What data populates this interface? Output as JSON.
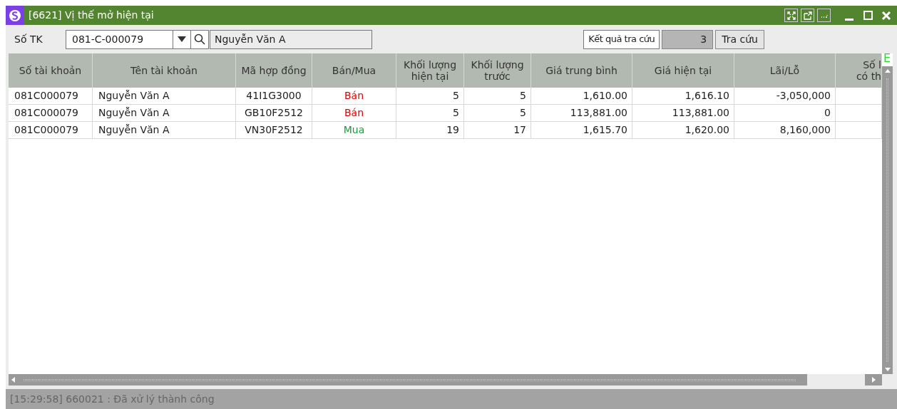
{
  "window": {
    "title": "[6621] Vị thế mở hiện tại"
  },
  "filter": {
    "label": "Số TK",
    "account": "081-C-000079",
    "name": "Nguyễn Văn A",
    "result_label": "Kết quả tra cứu",
    "result_count": "3",
    "search_button": "Tra cứu"
  },
  "table": {
    "columns": [
      {
        "lines": [
          "Số tài khoản"
        ]
      },
      {
        "lines": [
          "Tên tài khoản"
        ]
      },
      {
        "lines": [
          "Mã hợp đồng"
        ]
      },
      {
        "lines": [
          "Bán/Mua"
        ]
      },
      {
        "lines": [
          "Khối lượng",
          "hiện tại"
        ]
      },
      {
        "lines": [
          "Khối lượng",
          "trước"
        ]
      },
      {
        "lines": [
          "Giá trung bình"
        ]
      },
      {
        "lines": [
          "Giá hiện tại"
        ]
      },
      {
        "lines": [
          "Lãi/Lỗ"
        ]
      },
      {
        "lines": [
          "Số l",
          "có th"
        ]
      }
    ],
    "corner_mark": "E",
    "rows": [
      {
        "cells": [
          "081C000079",
          "Nguyễn Văn A",
          "41I1G3000",
          "Bán",
          "5",
          "5",
          "1,610.00",
          "1,616.10",
          "-3,050,000",
          ""
        ],
        "color": "#e00000"
      },
      {
        "cells": [
          "081C000079",
          "Nguyễn Văn A",
          "GB10F2512",
          "Bán",
          "5",
          "5",
          "113,881.00",
          "113,881.00",
          "0",
          ""
        ],
        "color": "#e00000"
      },
      {
        "cells": [
          "081C000079",
          "Nguyễn Văn A",
          "VN30F2512",
          "Mua",
          "19",
          "17",
          "1,615.70",
          "1,620.00",
          "8,160,000",
          ""
        ],
        "color": "#1a9a3a"
      }
    ]
  },
  "status_bar": "[15:29:58] 660021 : Đã xử lý thành công"
}
